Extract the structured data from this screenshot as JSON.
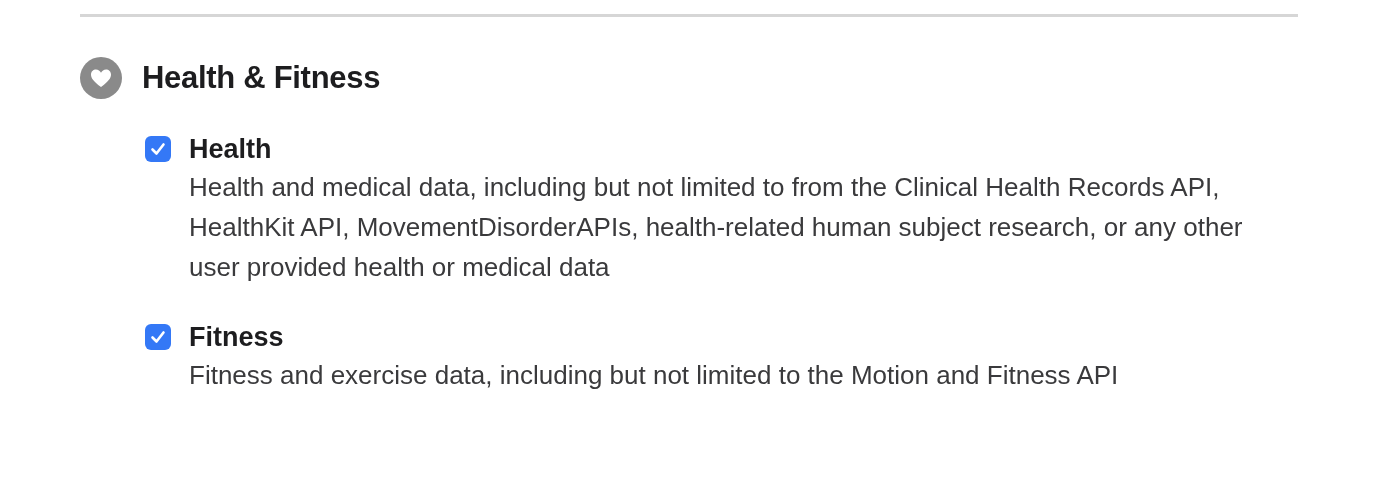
{
  "section": {
    "title": "Health & Fitness"
  },
  "items": [
    {
      "label": "Health",
      "checked": true,
      "description": "Health and medical data, including but not limited to from the Clinical Health Records API, HealthKit API, MovementDisorderAPIs, health-related human subject research, or any other user provided health or medical data"
    },
    {
      "label": "Fitness",
      "checked": true,
      "description": "Fitness and exercise data, including but not limited to the Motion and Fitness API"
    }
  ]
}
